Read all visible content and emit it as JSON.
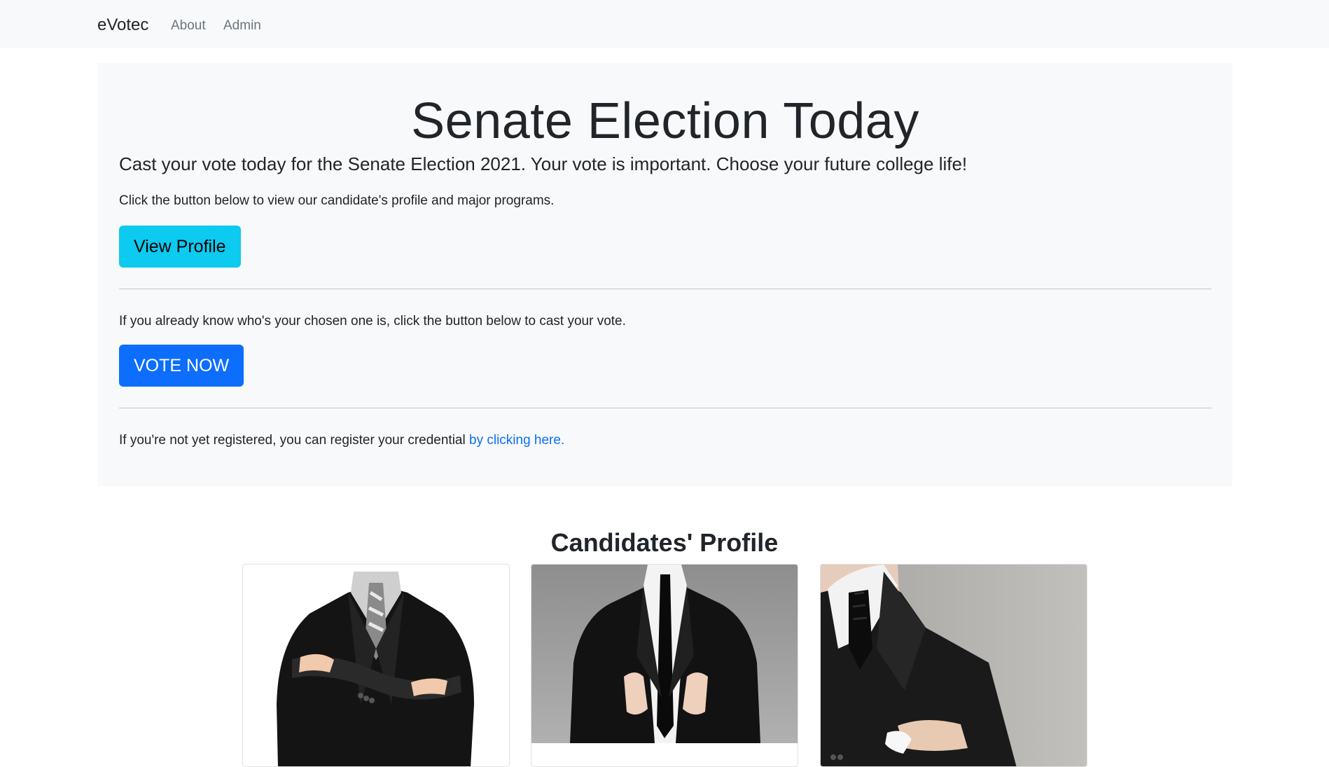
{
  "navbar": {
    "brand": "eVotec",
    "links": [
      "About",
      "Admin"
    ]
  },
  "jumbotron": {
    "title": "Senate Election Today",
    "lead": "Cast your vote today for the Senate Election 2021. Your vote is important. Choose your future college life!",
    "profile_text": "Click the button below to view our candidate's profile and major programs.",
    "profile_button": "View Profile",
    "vote_text": "If you already know who's your chosen one is, click the button below to cast your vote.",
    "vote_button": "VOTE NOW",
    "register_text": "If you're not yet registered, you can register your credential ",
    "register_link": "by clicking here."
  },
  "candidates": {
    "title": "Candidates' Profile",
    "cards": [
      {
        "image": "candidate-photo-1"
      },
      {
        "image": "candidate-photo-2"
      },
      {
        "image": "candidate-photo-3"
      }
    ]
  },
  "colors": {
    "navbar_bg": "#f8f9fa",
    "jumbotron_bg": "#f8f9fa",
    "info_button": "#0dcaf0",
    "primary_button": "#0d6efd",
    "link": "#0d6efd"
  }
}
